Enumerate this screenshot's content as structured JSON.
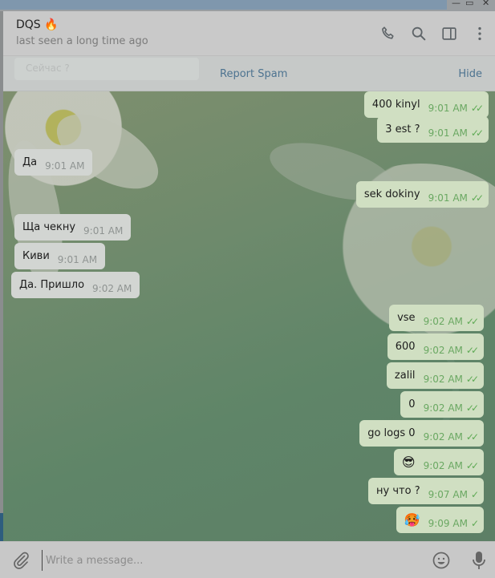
{
  "window": {
    "minimize_icon": "minimize-icon",
    "maximize_icon": "maximize-icon",
    "close_icon": "close-icon"
  },
  "header": {
    "name": "DQS 🔥",
    "status": "last seen a long time ago",
    "icons": [
      "phone-icon",
      "search-icon",
      "sidebar-icon",
      "more-icon"
    ]
  },
  "spam_bar": {
    "ghost_preview": "Сейчас ?",
    "report": "Report Spam",
    "hide": "Hide"
  },
  "messages": [
    {
      "dir": "out",
      "text": "400 kinyl",
      "time": "9:01 AM",
      "status": "read"
    },
    {
      "dir": "out",
      "text": "3 est ?",
      "time": "9:01 AM",
      "status": "read"
    },
    {
      "dir": "in",
      "text": "Да",
      "time": "9:01 AM"
    },
    {
      "dir": "out",
      "text": "sek dokiny",
      "time": "9:01 AM",
      "status": "read"
    },
    {
      "dir": "in",
      "text": "Ща чекну",
      "time": "9:01 AM"
    },
    {
      "dir": "in",
      "text": "Киви",
      "time": "9:01 AM"
    },
    {
      "dir": "in",
      "text": "Да. Пришло",
      "time": "9:02 AM"
    },
    {
      "dir": "out",
      "text": "vse",
      "time": "9:02 AM",
      "status": "read"
    },
    {
      "dir": "out",
      "text": "600",
      "time": "9:02 AM",
      "status": "read"
    },
    {
      "dir": "out",
      "text": "zalil",
      "time": "9:02 AM",
      "status": "read"
    },
    {
      "dir": "out",
      "text": "0",
      "time": "9:02 AM",
      "status": "read"
    },
    {
      "dir": "out",
      "text": "go logs 0",
      "time": "9:02 AM",
      "status": "read"
    },
    {
      "dir": "out",
      "text": "😎",
      "time": "9:02 AM",
      "status": "read"
    },
    {
      "dir": "out",
      "text": "ну что ?",
      "time": "9:07 AM",
      "status": "sent"
    },
    {
      "dir": "out",
      "text": "🥵",
      "time": "9:09 AM",
      "status": "sent"
    }
  ],
  "composer": {
    "placeholder": "Write a message...",
    "attach_icon": "paperclip-icon",
    "emoji_icon": "smile-icon",
    "mic_icon": "microphone-icon"
  },
  "colors": {
    "link": "#4d7390",
    "incoming_bubble": "#d2d5d2",
    "outgoing_bubble": "#d0dfc2",
    "check_green": "#5faa55"
  }
}
